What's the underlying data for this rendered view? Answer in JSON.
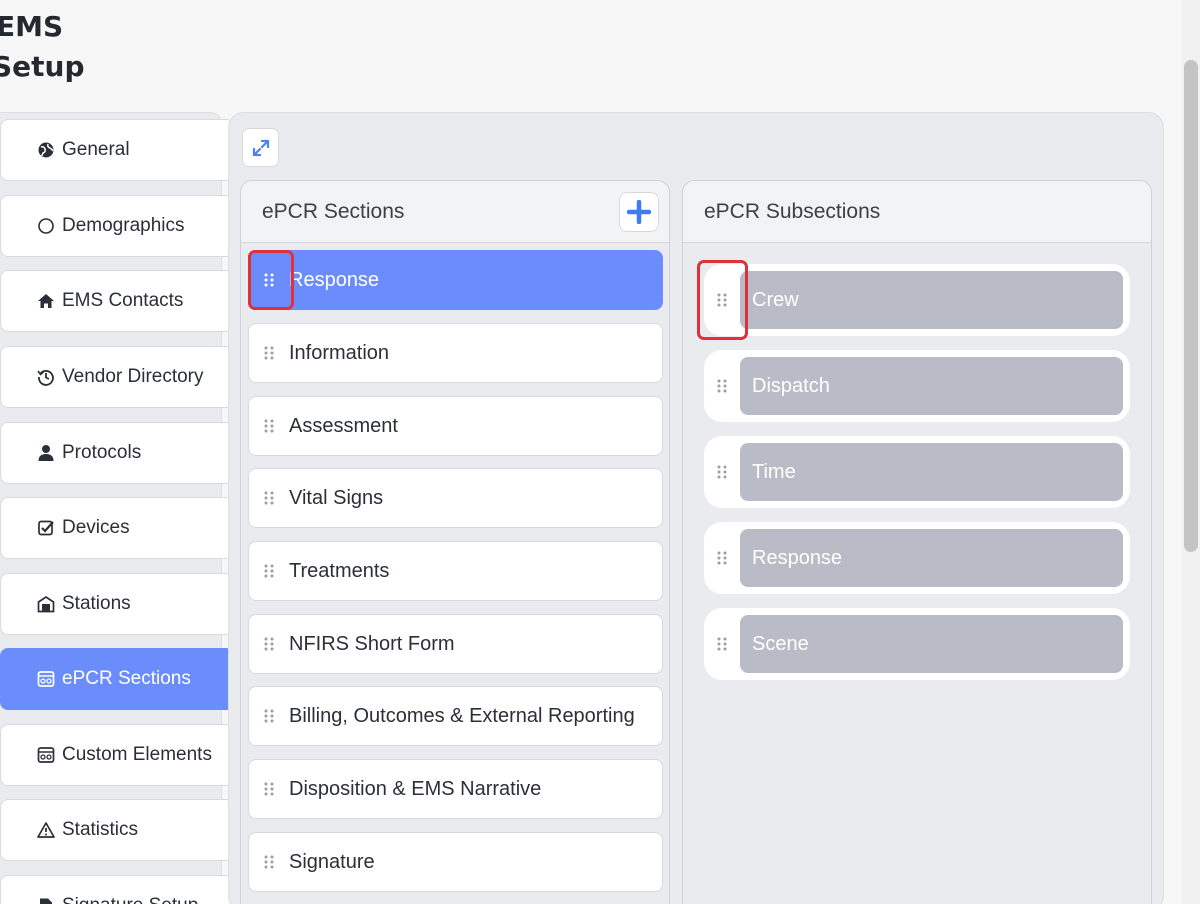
{
  "header": {
    "title": "EMS",
    "subtitle": "Setup"
  },
  "nav": {
    "items": [
      {
        "label": "General",
        "icon": "globe-icon"
      },
      {
        "label": "Demographics",
        "icon": "circle-icon"
      },
      {
        "label": "EMS Contacts",
        "icon": "home-icon"
      },
      {
        "label": "Vendor Directory",
        "icon": "history-icon"
      },
      {
        "label": "Protocols",
        "icon": "user-icon"
      },
      {
        "label": "Devices",
        "icon": "check-square-icon"
      },
      {
        "label": "Stations",
        "icon": "garage-icon"
      },
      {
        "label": "ePCR Sections",
        "icon": "sliders-box-icon",
        "active": true
      },
      {
        "label": "Custom Elements",
        "icon": "sliders-box-icon"
      },
      {
        "label": "Statistics",
        "icon": "warning-icon"
      },
      {
        "label": "Signature Setup",
        "icon": "document-icon"
      }
    ]
  },
  "sections_panel": {
    "title": "ePCR Sections",
    "items": [
      "Response",
      "Information",
      "Assessment",
      "Vital Signs",
      "Treatments",
      "NFIRS Short Form",
      "Billing, Outcomes & External Reporting",
      "Disposition & EMS Narrative",
      "Signature"
    ],
    "active_index": 0
  },
  "subsections_panel": {
    "title": "ePCR Subsections",
    "items": [
      "Crew",
      "Dispatch",
      "Time",
      "Response",
      "Scene"
    ]
  },
  "colors": {
    "accent": "#6b8dfb",
    "pill": "#b9bcc7",
    "highlight": "#e0303a",
    "add_plus": "#3f7bf5"
  }
}
